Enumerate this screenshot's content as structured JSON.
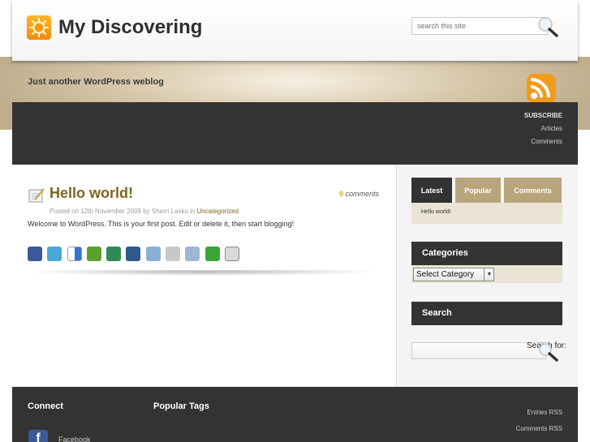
{
  "site": {
    "title": "My Discovering",
    "tagline": "Just another WordPress weblog",
    "logo_icon": "sun-icon",
    "search_placeholder": "search this site"
  },
  "subscribe": {
    "title": "SUBSCRIBE",
    "links": [
      "Articles",
      "Comments"
    ],
    "icon": "rss-icon"
  },
  "post": {
    "title": "Hello world!",
    "comments_count": "0",
    "comments_label": "comments",
    "meta_prefix": "Posted on 12th November 2009 by Sherri Lasko in",
    "category": "Uncategorized",
    "body": "Welcome to WordPress. This is your first post. Edit or delete it, then start blogging!",
    "share_icons": [
      "facebook-icon",
      "twitter-icon",
      "delicious-icon",
      "technorati-icon",
      "stumbleupon-icon",
      "digg-icon",
      "reddit-icon",
      "google-icon",
      "wordpress-icon",
      "addthis-icon",
      "email-icon"
    ]
  },
  "sidebar": {
    "tabs": [
      "Latest",
      "Popular",
      "Comments"
    ],
    "latest_item": "Hello world!",
    "categories_title": "Categories",
    "category_select": "Select Category",
    "search_title": "Search",
    "search_label": "Search for:"
  },
  "footer": {
    "connect_title": "Connect",
    "tags_title": "Popular Tags",
    "links": [
      "Entries RSS",
      "Comments RSS"
    ],
    "facebook_label": "Facebook"
  },
  "colors": {
    "accent": "#7e6520",
    "dark": "#333333",
    "tab_tan": "#b7a57b",
    "orange": "#e3a31a"
  }
}
